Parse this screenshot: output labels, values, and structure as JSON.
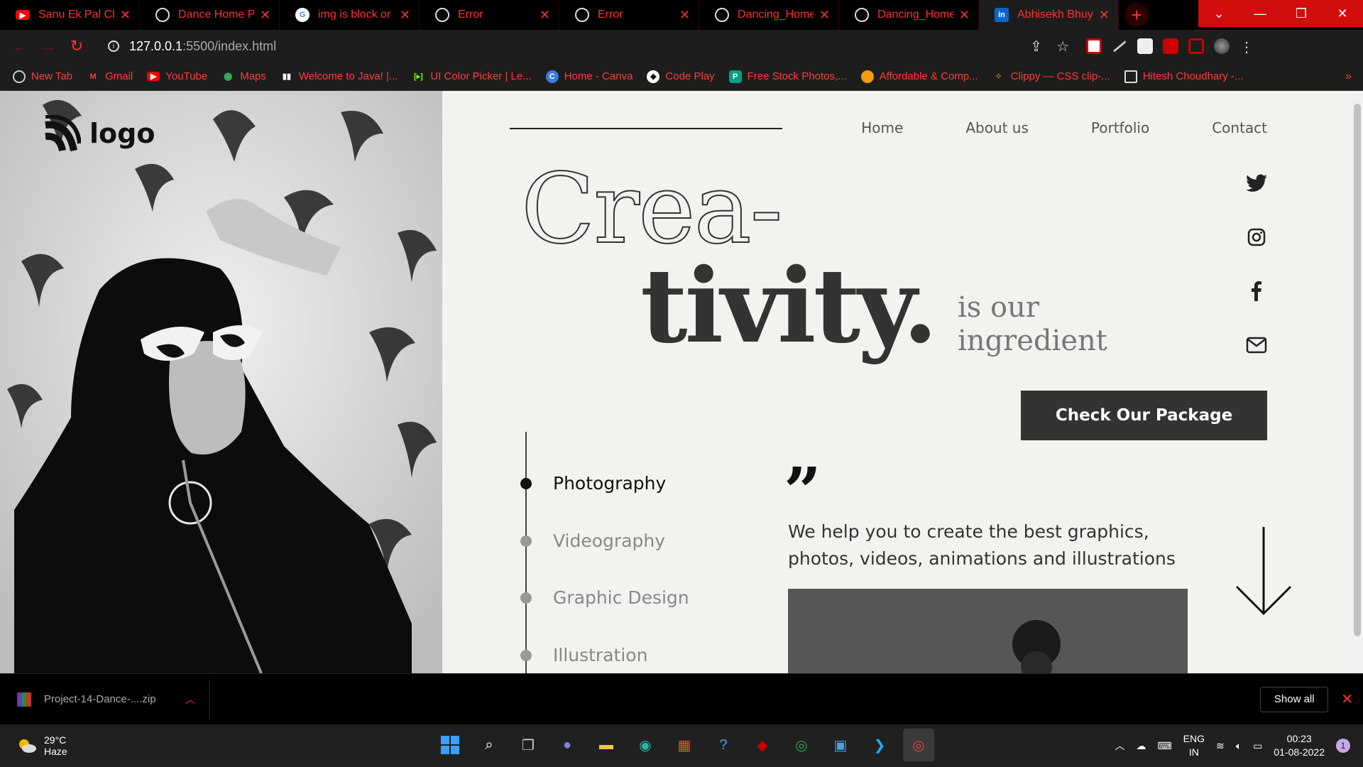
{
  "browser": {
    "tabs": [
      {
        "title": "Sanu Ek Pal Chain",
        "favicon": "youtube-icon"
      },
      {
        "title": "Dance Home Pag",
        "favicon": "globe-icon"
      },
      {
        "title": "img is block or in",
        "favicon": "google-icon"
      },
      {
        "title": "Error",
        "favicon": "globe-icon"
      },
      {
        "title": "Error",
        "favicon": "globe-icon"
      },
      {
        "title": "Dancing_Home_",
        "favicon": "globe-icon"
      },
      {
        "title": "Dancing_Home_",
        "favicon": "globe-icon"
      },
      {
        "title": "Abhisekh Bhuyan",
        "favicon": "linkedin-icon"
      }
    ],
    "url_host": "127.0.0.1",
    "url_rest": ":5500/index.html",
    "bookmarks": [
      {
        "label": "New Tab"
      },
      {
        "label": "Gmail"
      },
      {
        "label": "YouTube"
      },
      {
        "label": "Maps"
      },
      {
        "label": "Welcome to Java! |..."
      },
      {
        "label": "UI Color Picker | Le..."
      },
      {
        "label": "Home - Canva"
      },
      {
        "label": "Code Play"
      },
      {
        "label": "Free Stock Photos,..."
      },
      {
        "label": "Affordable & Comp..."
      },
      {
        "label": "Clippy — CSS clip-..."
      },
      {
        "label": "Hitesh Choudhary -..."
      }
    ]
  },
  "page": {
    "logo": "logo",
    "nav": [
      "Home",
      "About us",
      "Portfolio",
      "Contact"
    ],
    "headline_line1": "Crea-",
    "headline_line2": "tivity.",
    "tagline_line1": "is our",
    "tagline_line2": "ingredient",
    "cta": "Check Our Package",
    "services": [
      {
        "label": "Photography",
        "active": true
      },
      {
        "label": "Videography",
        "active": false
      },
      {
        "label": "Graphic Design",
        "active": false
      },
      {
        "label": "Illustration",
        "active": false
      }
    ],
    "quote_mark": "”",
    "description": "We help you to create the best graphics, photos, videos, animations and illustrations",
    "social": [
      "twitter-icon",
      "instagram-icon",
      "facebook-icon",
      "mail-icon"
    ]
  },
  "downloads": {
    "file": "Project-14-Dance-....zip",
    "show_all": "Show all"
  },
  "taskbar": {
    "temperature": "29°C",
    "condition": "Haze",
    "lang1": "ENG",
    "lang2": "IN",
    "time": "00:23",
    "date": "01-08-2022",
    "notifications": "1"
  },
  "colors": {
    "accent": "#ff2f2f",
    "page_bg": "#f4f2ef",
    "dark": "#333333"
  }
}
